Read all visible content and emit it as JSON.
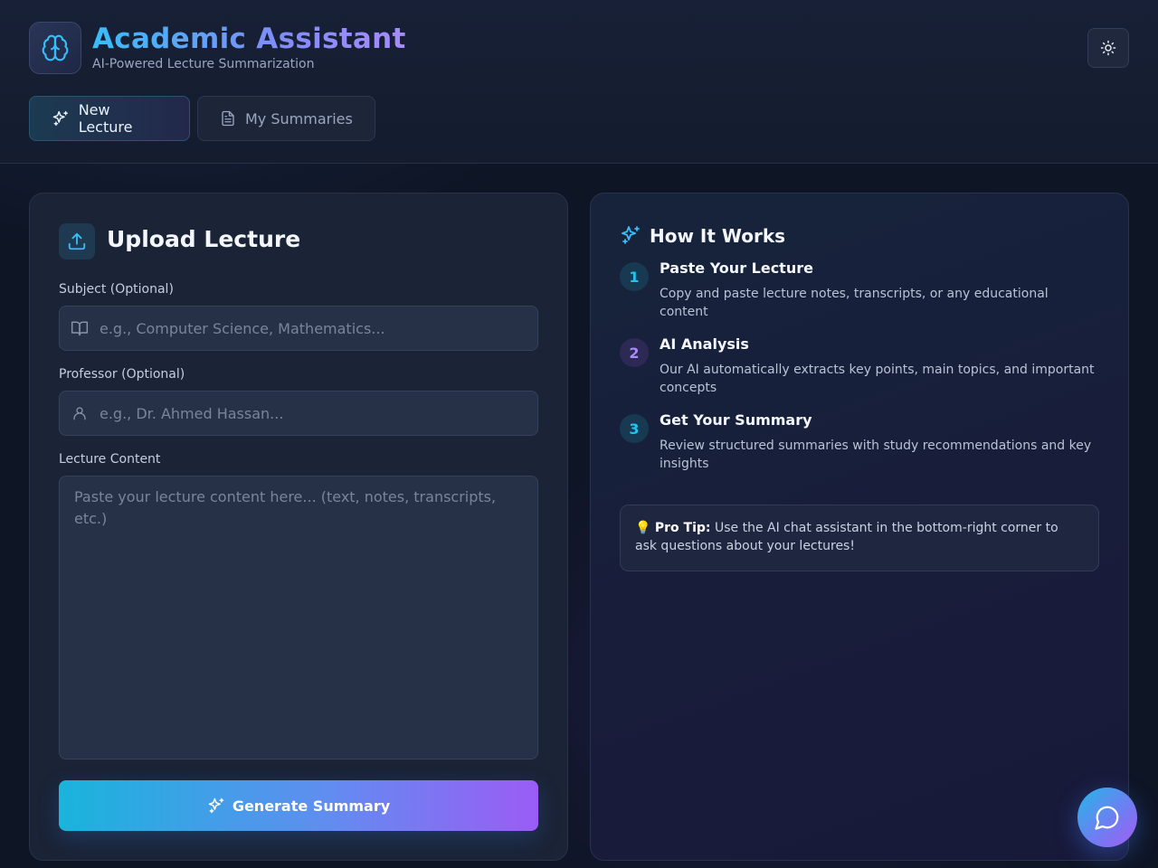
{
  "header": {
    "title": "Academic Assistant",
    "subtitle": "AI-Powered Lecture Summarization",
    "logo_icon": "brain-icon",
    "theme_icon": "sun-icon"
  },
  "tabs": [
    {
      "label": "New Lecture",
      "icon": "sparkles-icon",
      "active": true
    },
    {
      "label": "My Summaries",
      "icon": "document-icon",
      "active": false
    }
  ],
  "upload": {
    "title": "Upload Lecture",
    "subject_label": "Subject (Optional)",
    "subject_placeholder": "e.g., Computer Science, Mathematics...",
    "subject_value": "",
    "professor_label": "Professor (Optional)",
    "professor_placeholder": "e.g., Dr. Ahmed Hassan...",
    "professor_value": "",
    "content_label": "Lecture Content",
    "content_placeholder": "Paste your lecture content here... (text, notes, transcripts, etc.)",
    "content_value": "",
    "generate_label": "Generate Summary"
  },
  "how_it_works": {
    "title": "How It Works",
    "steps": [
      {
        "number": "1",
        "title": "Paste Your Lecture",
        "description": "Copy and paste lecture notes, transcripts, or any educational content"
      },
      {
        "number": "2",
        "title": "AI Analysis",
        "description": "Our AI automatically extracts key points, main topics, and important concepts"
      },
      {
        "number": "3",
        "title": "Get Your Summary",
        "description": "Review structured summaries with study recommendations and key insights"
      }
    ],
    "tip_emoji": "💡",
    "tip_label": "Pro Tip:",
    "tip_text": " Use the AI chat assistant in the bottom-right corner to ask questions about your lectures!"
  },
  "colors": {
    "accent_cyan": "#38bdf8",
    "accent_violet": "#a78bfa",
    "step1": "#22c3ee",
    "step2": "#a78bfa",
    "step3": "#22c3ee"
  }
}
